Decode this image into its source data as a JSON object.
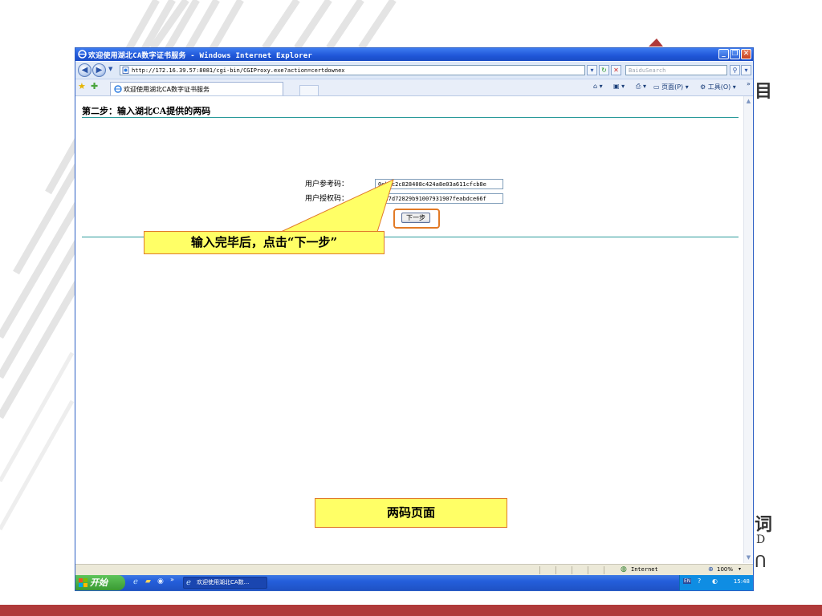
{
  "window": {
    "title": "欢迎使用湖北CA数字证书服务 - Windows Internet Explorer",
    "min_label": "_",
    "max_label": "❐",
    "close_label": "✕"
  },
  "address_bar": {
    "url": "http://172.16.39.57:8081/cgi-bin/CGIProxy.exe?action=certdownex",
    "search_placeholder": "BaiduSearch"
  },
  "tab": {
    "label": "欢迎使用湖北CA数字证书服务"
  },
  "command_bar": {
    "page_menu": "页面(P)",
    "tools_menu": "工具(O)"
  },
  "page": {
    "step_title": "第二步：输入湖北CA提供的两码",
    "ref_code_label": "用户参考码：",
    "ref_code_value": "0ebbc2c828408c424a8e03a611cfcb8e",
    "auth_code_label": "用户授权码：",
    "auth_code_value": "9cd7d72829b91007931907feabdce66f",
    "next_button": "下一步"
  },
  "status_bar": {
    "zone": "Internet",
    "zoom": "100%"
  },
  "taskbar": {
    "start": "开始",
    "task_item": "欢迎使用湖北CA数...",
    "clock": "15:48"
  },
  "callouts": {
    "next_hint": "输入完毕后，点击“下一步”",
    "page_caption": "两码页面"
  },
  "colors": {
    "title_bar": "#1f56d8",
    "rule": "#2a9a9a",
    "highlight": "#e27a26",
    "callout_fill": "#ffff66",
    "bottom_bar": "#b03a3a"
  }
}
